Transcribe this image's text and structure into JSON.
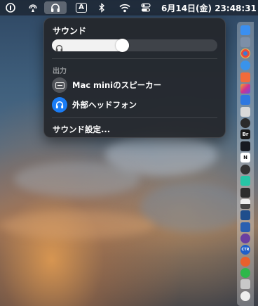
{
  "menubar": {
    "clock": "6月14日(金) 23:48:31",
    "input_indicator": "A"
  },
  "sound_popup": {
    "title": "サウンド",
    "volume_percent": 42,
    "output_section_label": "出力",
    "devices": [
      {
        "label": "Mac miniのスピーカー",
        "icon": "speaker-icon",
        "selected": false
      },
      {
        "label": "外部ヘッドフォン",
        "icon": "headphones-icon",
        "selected": true
      }
    ],
    "settings_link": "サウンド設定..."
  },
  "dock": {
    "icon_texts": [
      "Br",
      "CTR"
    ]
  },
  "colors": {
    "accent_blue": "#1a7cf5",
    "popup_bg": "#24262a"
  }
}
